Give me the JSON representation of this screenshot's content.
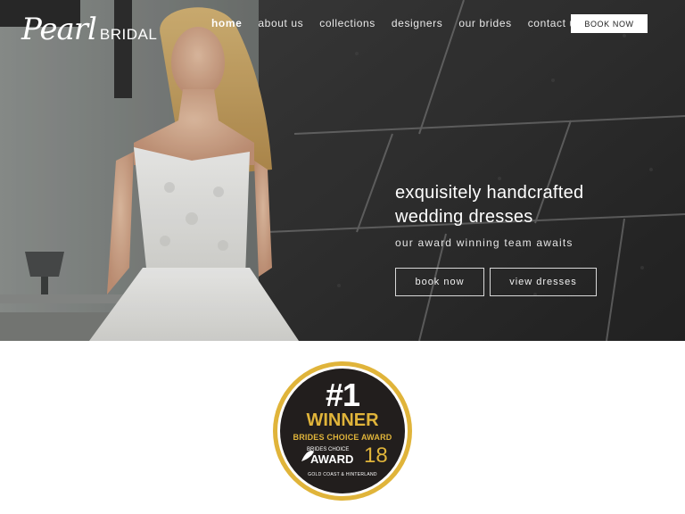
{
  "brand": {
    "script": "Pearl",
    "word": "BRIDAL"
  },
  "nav": {
    "items": [
      {
        "label": "home",
        "active": true
      },
      {
        "label": "about us",
        "active": false
      },
      {
        "label": "collections",
        "active": false
      },
      {
        "label": "designers",
        "active": false
      },
      {
        "label": "our brides",
        "active": false
      },
      {
        "label": "contact us",
        "active": false
      }
    ],
    "cta": "BOOK NOW"
  },
  "hero": {
    "headline_line1": "exquisitely handcrafted",
    "headline_line2": "wedding dresses",
    "subline": "our award winning team awaits",
    "buttons": {
      "book": "book now",
      "view": "view dresses"
    }
  },
  "award": {
    "rank": "#1",
    "winner": "WINNER",
    "title": "BRIDES CHOICE AWARD",
    "small": "BRIDES CHOICE",
    "award_word": "AWARD",
    "year": "18",
    "region": "GOLD COAST & HINTERLAND"
  },
  "colors": {
    "gold": "#e0b43a",
    "badge_bg": "#221e1d",
    "white": "#ffffff"
  }
}
